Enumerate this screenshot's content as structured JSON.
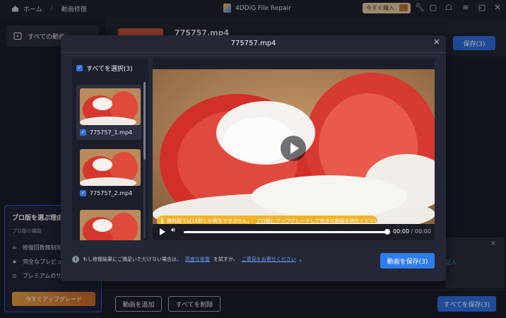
{
  "titlebar": {
    "home": "ホーム",
    "separator": "/",
    "section": "動画修復",
    "app_title": "4DDiG File Repair",
    "buy_label": "今すぐ購入"
  },
  "sidebar": {
    "all_videos": "すべての動画",
    "promo": {
      "title": "プロ版を選ぶ理由",
      "subtitle": "プロ版の機能",
      "features": [
        "修復回数無制限",
        "完全なプレビュー",
        "プレミアムのサ"
      ],
      "upgrade": "今すぐアップグレード"
    }
  },
  "main": {
    "file_title": "775757.mp4",
    "save_label": "保存(3)",
    "side_panel_link": "記入",
    "add_video": "動画を追加",
    "delete_all": "すべてを削除",
    "save_all": "すべてを保存(3)"
  },
  "modal": {
    "title": "775757.mp4",
    "select_all": "すべてを選択(3)",
    "files": [
      {
        "name": "775757_1.mp4"
      },
      {
        "name": "775757_2.mp4"
      },
      {
        "name": ""
      }
    ],
    "warning": {
      "text": "無料版では15秒しか再生できません。",
      "link": "プロ版にアップグレードして完全な動画を再生ください。"
    },
    "player": {
      "time_current": "00:00",
      "time_separator": "/",
      "time_total": "00:00",
      "progress": 1.0
    },
    "note": {
      "prefix": "もし修復結果にご満足いただけない場合は、",
      "link1": "高度な修復",
      "middle": "を試すか、",
      "link2": "ご意見をお寄せください",
      "suffix": "。"
    },
    "save_button": "動画を保存(3)"
  },
  "colors": {
    "accent": "#2f6fe0",
    "warning": "#f2b227",
    "background": "#1b1e2a",
    "modal": "#242735"
  }
}
